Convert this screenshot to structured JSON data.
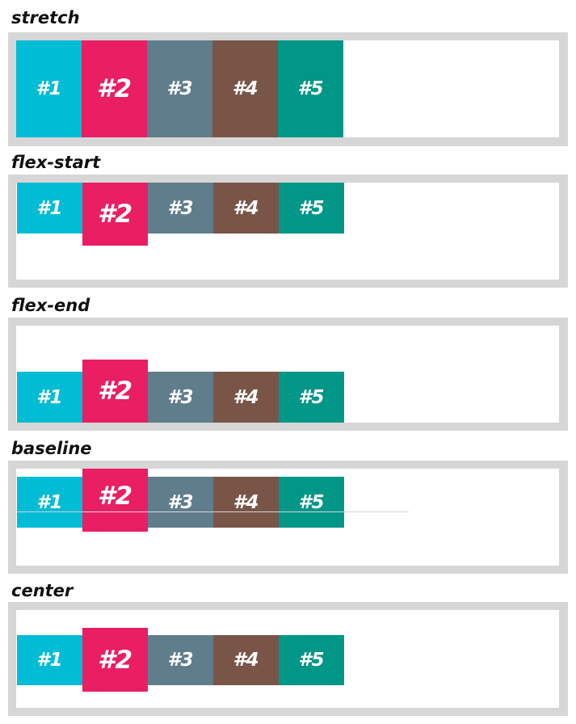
{
  "sections": [
    {
      "title": "stretch"
    },
    {
      "title": "flex-start"
    },
    {
      "title": "flex-end"
    },
    {
      "title": "baseline"
    },
    {
      "title": "center"
    }
  ],
  "items": [
    {
      "label": "#1",
      "color": "#00bcd4"
    },
    {
      "label": "#2",
      "color": "#e91e63"
    },
    {
      "label": "#3",
      "color": "#607d8b"
    },
    {
      "label": "#4",
      "color": "#795548"
    },
    {
      "label": "#5",
      "color": "#009688"
    }
  ],
  "colors": {
    "frame": "#d6d6d6",
    "inner": "#ffffff",
    "text": "#ffffff"
  }
}
